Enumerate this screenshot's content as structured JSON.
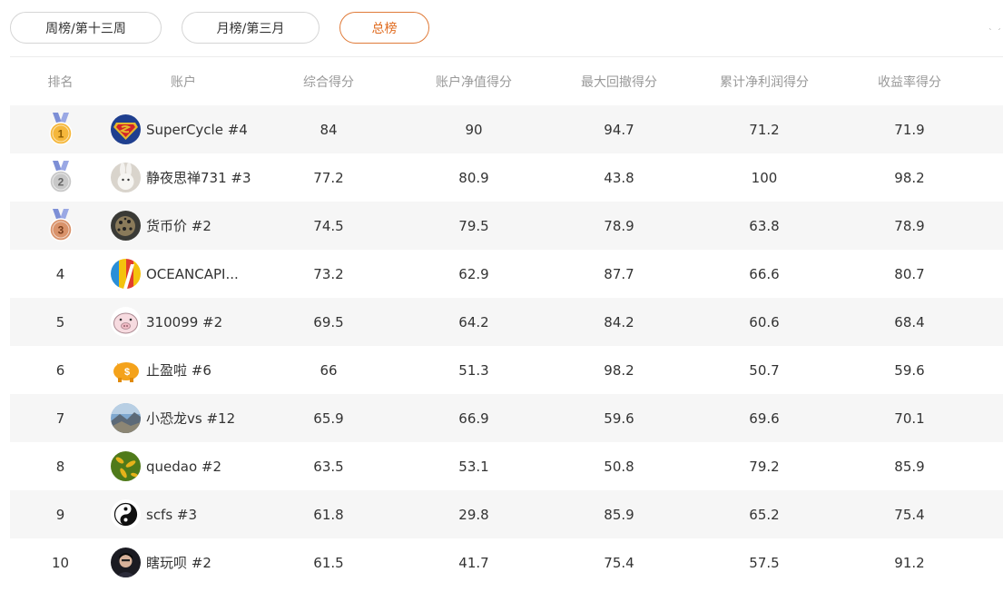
{
  "tabs": [
    {
      "label": "周榜/第十三周",
      "active": false
    },
    {
      "label": "月榜/第三月",
      "active": false
    },
    {
      "label": "总榜",
      "active": true
    }
  ],
  "corner_mark": "ˎ ˏ",
  "colors": {
    "accent": "#e07b39",
    "medal_ribbon": "#7d8fd6",
    "gold": "#f5b73b",
    "silver": "#c8c8c8",
    "bronze": "#d9926a",
    "row_shade": "#f6f6f6"
  },
  "table": {
    "headers": [
      "排名",
      "账户",
      "综合得分",
      "账户净值得分",
      "最大回撤得分",
      "累计净利润得分",
      "收益率得分"
    ],
    "rows": [
      {
        "rank": "1",
        "medal": "gold-medal-icon",
        "avatar": "superman-avatar",
        "account": "SuperCycle #4",
        "composite": "84",
        "net_value": "90",
        "max_drawdown": "94.7",
        "net_profit": "71.2",
        "return_rate": "71.9"
      },
      {
        "rank": "2",
        "medal": "silver-medal-icon",
        "avatar": "rabbit-avatar",
        "account": "静夜思禅731 #3",
        "composite": "77.2",
        "net_value": "80.9",
        "max_drawdown": "43.8",
        "net_profit": "100",
        "return_rate": "98.2"
      },
      {
        "rank": "3",
        "medal": "bronze-medal-icon",
        "avatar": "leopard-avatar",
        "account": "货币价 #2",
        "composite": "74.5",
        "net_value": "79.5",
        "max_drawdown": "78.9",
        "net_profit": "63.8",
        "return_rate": "78.9"
      },
      {
        "rank": "4",
        "medal": "",
        "avatar": "colorful-logo-avatar",
        "account": "OCEANCAPI...",
        "composite": "73.2",
        "net_value": "62.9",
        "max_drawdown": "87.7",
        "net_profit": "66.6",
        "return_rate": "80.7"
      },
      {
        "rank": "5",
        "medal": "",
        "avatar": "pig-avatar",
        "account": "310099 #2",
        "composite": "69.5",
        "net_value": "64.2",
        "max_drawdown": "84.2",
        "net_profit": "60.6",
        "return_rate": "68.4"
      },
      {
        "rank": "6",
        "medal": "",
        "avatar": "piggy-bank-avatar",
        "account": "止盈啦 #6",
        "composite": "66",
        "net_value": "51.3",
        "max_drawdown": "98.2",
        "net_profit": "50.7",
        "return_rate": "59.6"
      },
      {
        "rank": "7",
        "medal": "",
        "avatar": "landscape-avatar",
        "account": "小恐龙vs #12",
        "composite": "65.9",
        "net_value": "66.9",
        "max_drawdown": "59.6",
        "net_profit": "69.6",
        "return_rate": "70.1"
      },
      {
        "rank": "8",
        "medal": "",
        "avatar": "leaf-pattern-avatar",
        "account": "quedao #2",
        "composite": "63.5",
        "net_value": "53.1",
        "max_drawdown": "50.8",
        "net_profit": "79.2",
        "return_rate": "85.9"
      },
      {
        "rank": "9",
        "medal": "",
        "avatar": "yin-yang-avatar",
        "account": "scfs #3",
        "composite": "61.8",
        "net_value": "29.8",
        "max_drawdown": "85.9",
        "net_profit": "65.2",
        "return_rate": "75.4"
      },
      {
        "rank": "10",
        "medal": "",
        "avatar": "person-avatar",
        "account": "瞎玩呗 #2",
        "composite": "61.5",
        "net_value": "41.7",
        "max_drawdown": "75.4",
        "net_profit": "57.5",
        "return_rate": "91.2"
      }
    ]
  }
}
